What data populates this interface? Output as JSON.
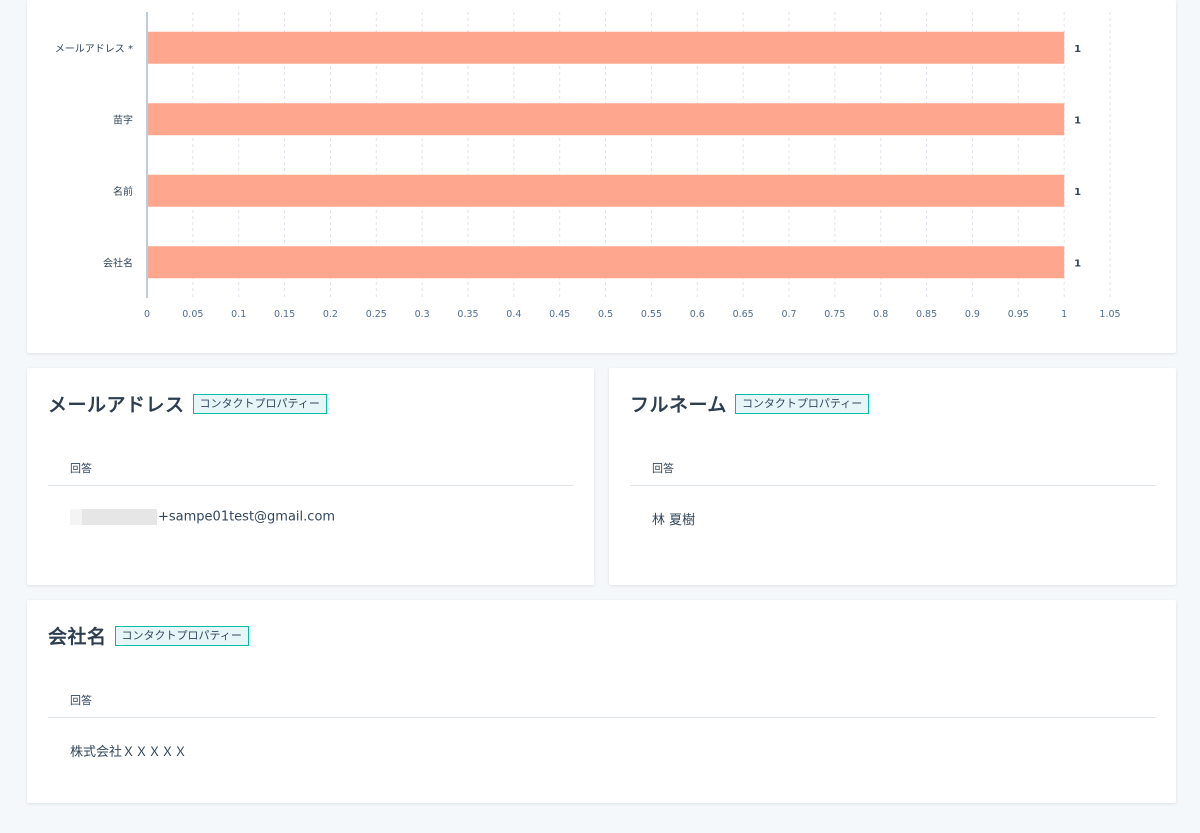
{
  "chart_data": {
    "type": "bar",
    "orientation": "horizontal",
    "categories": [
      "メールアドレス *",
      "苗字",
      "名前",
      "会社名"
    ],
    "values": [
      1,
      1,
      1,
      1
    ],
    "xlim": [
      0,
      1.05
    ],
    "xticks": [
      "0",
      "0.05",
      "0.1",
      "0.15",
      "0.2",
      "0.25",
      "0.3",
      "0.35",
      "0.4",
      "0.45",
      "0.5",
      "0.55",
      "0.6",
      "0.65",
      "0.7",
      "0.75",
      "0.8",
      "0.85",
      "0.9",
      "0.95",
      "1",
      "1.05"
    ],
    "grid": true,
    "bar_color": "#ffa78e",
    "data_labels": [
      "1",
      "1",
      "1",
      "1"
    ]
  },
  "cards": {
    "email": {
      "title": "メールアドレス",
      "tag": "コンタクトプロパティー",
      "column": "回答",
      "answer": "+sampe01test@gmail.com"
    },
    "fullname": {
      "title": "フルネーム",
      "tag": "コンタクトプロパティー",
      "column": "回答",
      "answer": "林 夏樹"
    },
    "company": {
      "title": "会社名",
      "tag": "コンタクトプロパティー",
      "column": "回答",
      "answer": "株式会社ＸＸＸＸＸ"
    }
  },
  "colors": {
    "tag_border": "#00bda5",
    "tag_bg": "#e5f5f8",
    "background": "#f5f8fa"
  }
}
